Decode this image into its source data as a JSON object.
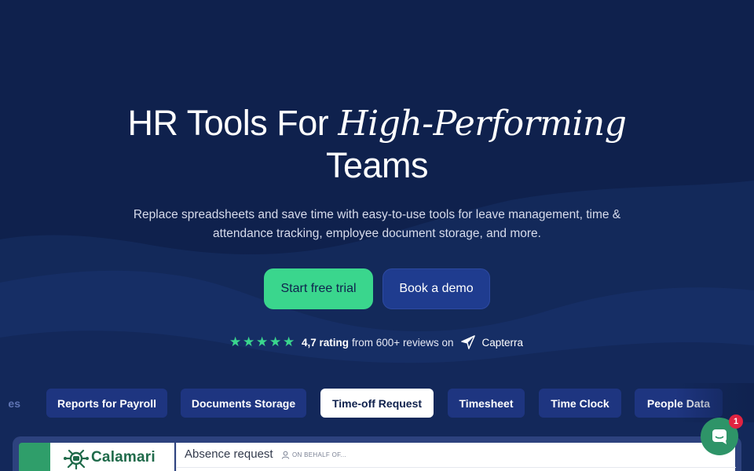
{
  "hero": {
    "title_prefix": "HR Tools For",
    "title_accent": "High-Performing",
    "title_suffix": "Teams",
    "subtitle": "Replace spreadsheets and save time with easy-to-use tools for leave management, time & attendance tracking, employee document storage, and more.",
    "primary_cta": "Start free trial",
    "secondary_cta": "Book a demo"
  },
  "rating": {
    "stars": 5,
    "score_text": "4,7 rating",
    "reviews_text": "from 600+ reviews on",
    "platform": "Capterra",
    "star_icon": "star-icon",
    "platform_icon": "capterra-logo-icon"
  },
  "tabs": [
    {
      "label": "es",
      "active": false
    },
    {
      "label": "Reports for Payroll",
      "active": false
    },
    {
      "label": "Documents Storage",
      "active": false
    },
    {
      "label": "Time-off Request",
      "active": true
    },
    {
      "label": "Timesheet",
      "active": false
    },
    {
      "label": "Time Clock",
      "active": false
    },
    {
      "label": "People Data",
      "active": false
    }
  ],
  "app_preview": {
    "brand": "Calamari",
    "heading": "Absence request",
    "on_behalf": "ON BEHALF OF..."
  },
  "chat": {
    "badge_count": "1",
    "icon": "chat-bubble-icon"
  },
  "colors": {
    "background": "#0f214d",
    "accent_green": "#3ad68d",
    "button_blue": "#1f3c8f",
    "tab_blue": "#1e3580",
    "badge_red": "#e02341"
  }
}
